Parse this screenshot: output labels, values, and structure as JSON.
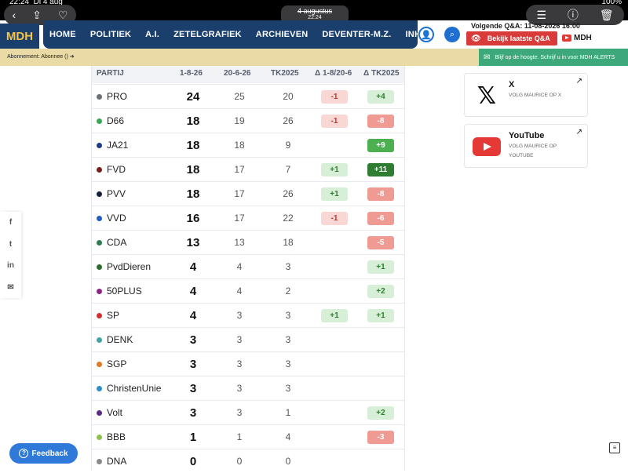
{
  "status_bar": {
    "time": "22:24",
    "day": "Di 4 aug",
    "battery": "100%"
  },
  "browser": {
    "date_top": "4 augustus",
    "date_bottom": "22:24"
  },
  "header": {
    "logo": "MDH",
    "nav": [
      "HOME",
      "POLITIEK",
      "A.I.",
      "ZETELGRAFIEK",
      "ARCHIEVEN",
      "DEVENTER-M.Z.",
      "INHOUD"
    ],
    "next_qa": "Volgende Q&A: 11-08-2026 16:00",
    "qa_button": "Bekijk laatste Q&A",
    "mdh_small": "MDH"
  },
  "subscription": {
    "text": "Abonnement: Abonnee ()",
    "arrow": "➔"
  },
  "alerts": {
    "text": "Blijf op de hoogte. Schrijf u in voor MDH ALERTS"
  },
  "table": {
    "headers": [
      "PARTIJ",
      "1-8-26",
      "20-6-26",
      "TK2025",
      "Δ 1-8/20-6",
      "Δ TK2025"
    ],
    "rows": [
      {
        "party": "PRO",
        "color": "#6b6f76",
        "v1": "24",
        "v2": "25",
        "v3": "20",
        "d1": "-1",
        "d2": "+4"
      },
      {
        "party": "D66",
        "color": "#3aa757",
        "v1": "18",
        "v2": "19",
        "v3": "26",
        "d1": "-1",
        "d2": "-8"
      },
      {
        "party": "JA21",
        "color": "#1f3a8a",
        "v1": "18",
        "v2": "18",
        "v3": "9",
        "d1": "",
        "d2": "+9"
      },
      {
        "party": "FVD",
        "color": "#7a1c1c",
        "v1": "18",
        "v2": "17",
        "v3": "7",
        "d1": "+1",
        "d2": "+11"
      },
      {
        "party": "PVV",
        "color": "#16203d",
        "v1": "18",
        "v2": "17",
        "v3": "26",
        "d1": "+1",
        "d2": "-8"
      },
      {
        "party": "VVD",
        "color": "#1f5fbf",
        "v1": "16",
        "v2": "17",
        "v3": "22",
        "d1": "-1",
        "d2": "-6"
      },
      {
        "party": "CDA",
        "color": "#2e7d4f",
        "v1": "13",
        "v2": "13",
        "v3": "18",
        "d1": "",
        "d2": "-5"
      },
      {
        "party": "PvdDieren",
        "color": "#2e6b2e",
        "v1": "4",
        "v2": "4",
        "v3": "3",
        "d1": "",
        "d2": "+1"
      },
      {
        "party": "50PLUS",
        "color": "#8e2487",
        "v1": "4",
        "v2": "4",
        "v3": "2",
        "d1": "",
        "d2": "+2"
      },
      {
        "party": "SP",
        "color": "#d32f2f",
        "v1": "4",
        "v2": "3",
        "v3": "3",
        "d1": "+1",
        "d2": "+1"
      },
      {
        "party": "DENK",
        "color": "#3fa6a6",
        "v1": "3",
        "v2": "3",
        "v3": "3",
        "d1": "",
        "d2": ""
      },
      {
        "party": "SGP",
        "color": "#e07b22",
        "v1": "3",
        "v2": "3",
        "v3": "3",
        "d1": "",
        "d2": ""
      },
      {
        "party": "ChristenUnie",
        "color": "#2b8fcf",
        "v1": "3",
        "v2": "3",
        "v3": "3",
        "d1": "",
        "d2": ""
      },
      {
        "party": "Volt",
        "color": "#5b2a8a",
        "v1": "3",
        "v2": "3",
        "v3": "1",
        "d1": "",
        "d2": "+2"
      },
      {
        "party": "BBB",
        "color": "#8bc34a",
        "v1": "1",
        "v2": "1",
        "v3": "4",
        "d1": "",
        "d2": "-3"
      },
      {
        "party": "DNA",
        "color": "#8a8a8a",
        "v1": "0",
        "v2": "0",
        "v3": "0",
        "d1": "",
        "d2": ""
      }
    ],
    "colors": {
      "neg_light_bg": "#f8d7d5",
      "neg_light_fg": "#c0392b",
      "neg_mid_bg": "#ef9a92",
      "neg_mid_fg": "#ffffff",
      "pos_light_bg": "#d6efd6",
      "pos_light_fg": "#2e7d32",
      "pos_mid_bg": "#4caf50",
      "pos_dark_bg": "#2e7d32",
      "pos_fg": "#ffffff"
    }
  },
  "social": {
    "x": {
      "title": "X",
      "sub": "VOLG MAURICE OP X"
    },
    "youtube": {
      "title": "YouTube",
      "sub": "VOLG MAURICE OP YOUTUBE"
    }
  },
  "share": [
    "f",
    "t",
    "in",
    "✉"
  ],
  "feedback": "Feedback"
}
